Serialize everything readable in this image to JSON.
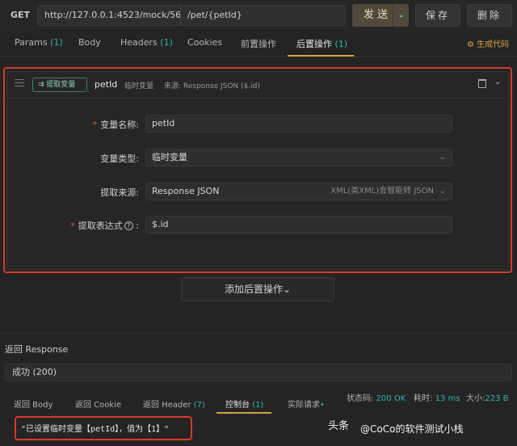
{
  "request": {
    "method": "GET",
    "url_base": "http://127.0.0.1:4523/mock/56",
    "url_path": "/pet/{petId}",
    "send_label": "发送",
    "save_label": "保存",
    "delete_label": "删除"
  },
  "tabs": [
    {
      "label": "Params",
      "count": "(1)"
    },
    {
      "label": "Body",
      "count": ""
    },
    {
      "label": "Headers",
      "count": "(1)"
    },
    {
      "label": "Cookies",
      "count": ""
    },
    {
      "label": "前置操作",
      "count": ""
    },
    {
      "label": "后置操作",
      "count": "(1)",
      "active": true
    }
  ],
  "gen_code": "生成代码",
  "extract": {
    "chip": "提取变量",
    "name": "petId",
    "type_short": "临时变量",
    "source_short": "来源: Response JSON ($.id)",
    "fields": {
      "var_name": {
        "label": "变量名称:",
        "value": "petId"
      },
      "var_type": {
        "label": "变量类型:",
        "value": "临时变量"
      },
      "source": {
        "label": "提取来源:",
        "value": "Response JSON",
        "hint": "XML(类XML)会智能转 JSON"
      },
      "expression": {
        "label": "提取表达式",
        "value": "$.id"
      }
    }
  },
  "add_post_op": "添加后置操作",
  "response": {
    "title": "返回 Response",
    "status_select": "成功 (200)",
    "tabs": [
      {
        "label": "返回 Body",
        "count": ""
      },
      {
        "label": "返回 Cookie",
        "count": ""
      },
      {
        "label": "返回 Header",
        "count": "(7)"
      },
      {
        "label": "控制台",
        "count": "(1)",
        "active": true
      },
      {
        "label": "实际请求",
        "count": ""
      }
    ],
    "status_label": "状态码:",
    "status_value": "200 OK",
    "time_label": "耗时:",
    "time_value": "13 ms",
    "size_label": "大小:",
    "size_value": "223 B",
    "console_line": "\"已设置临时变量【petId】，值为【1】\""
  },
  "watermark": {
    "prefix": "头条",
    "text": "@CoCo的软件测试小栈"
  }
}
